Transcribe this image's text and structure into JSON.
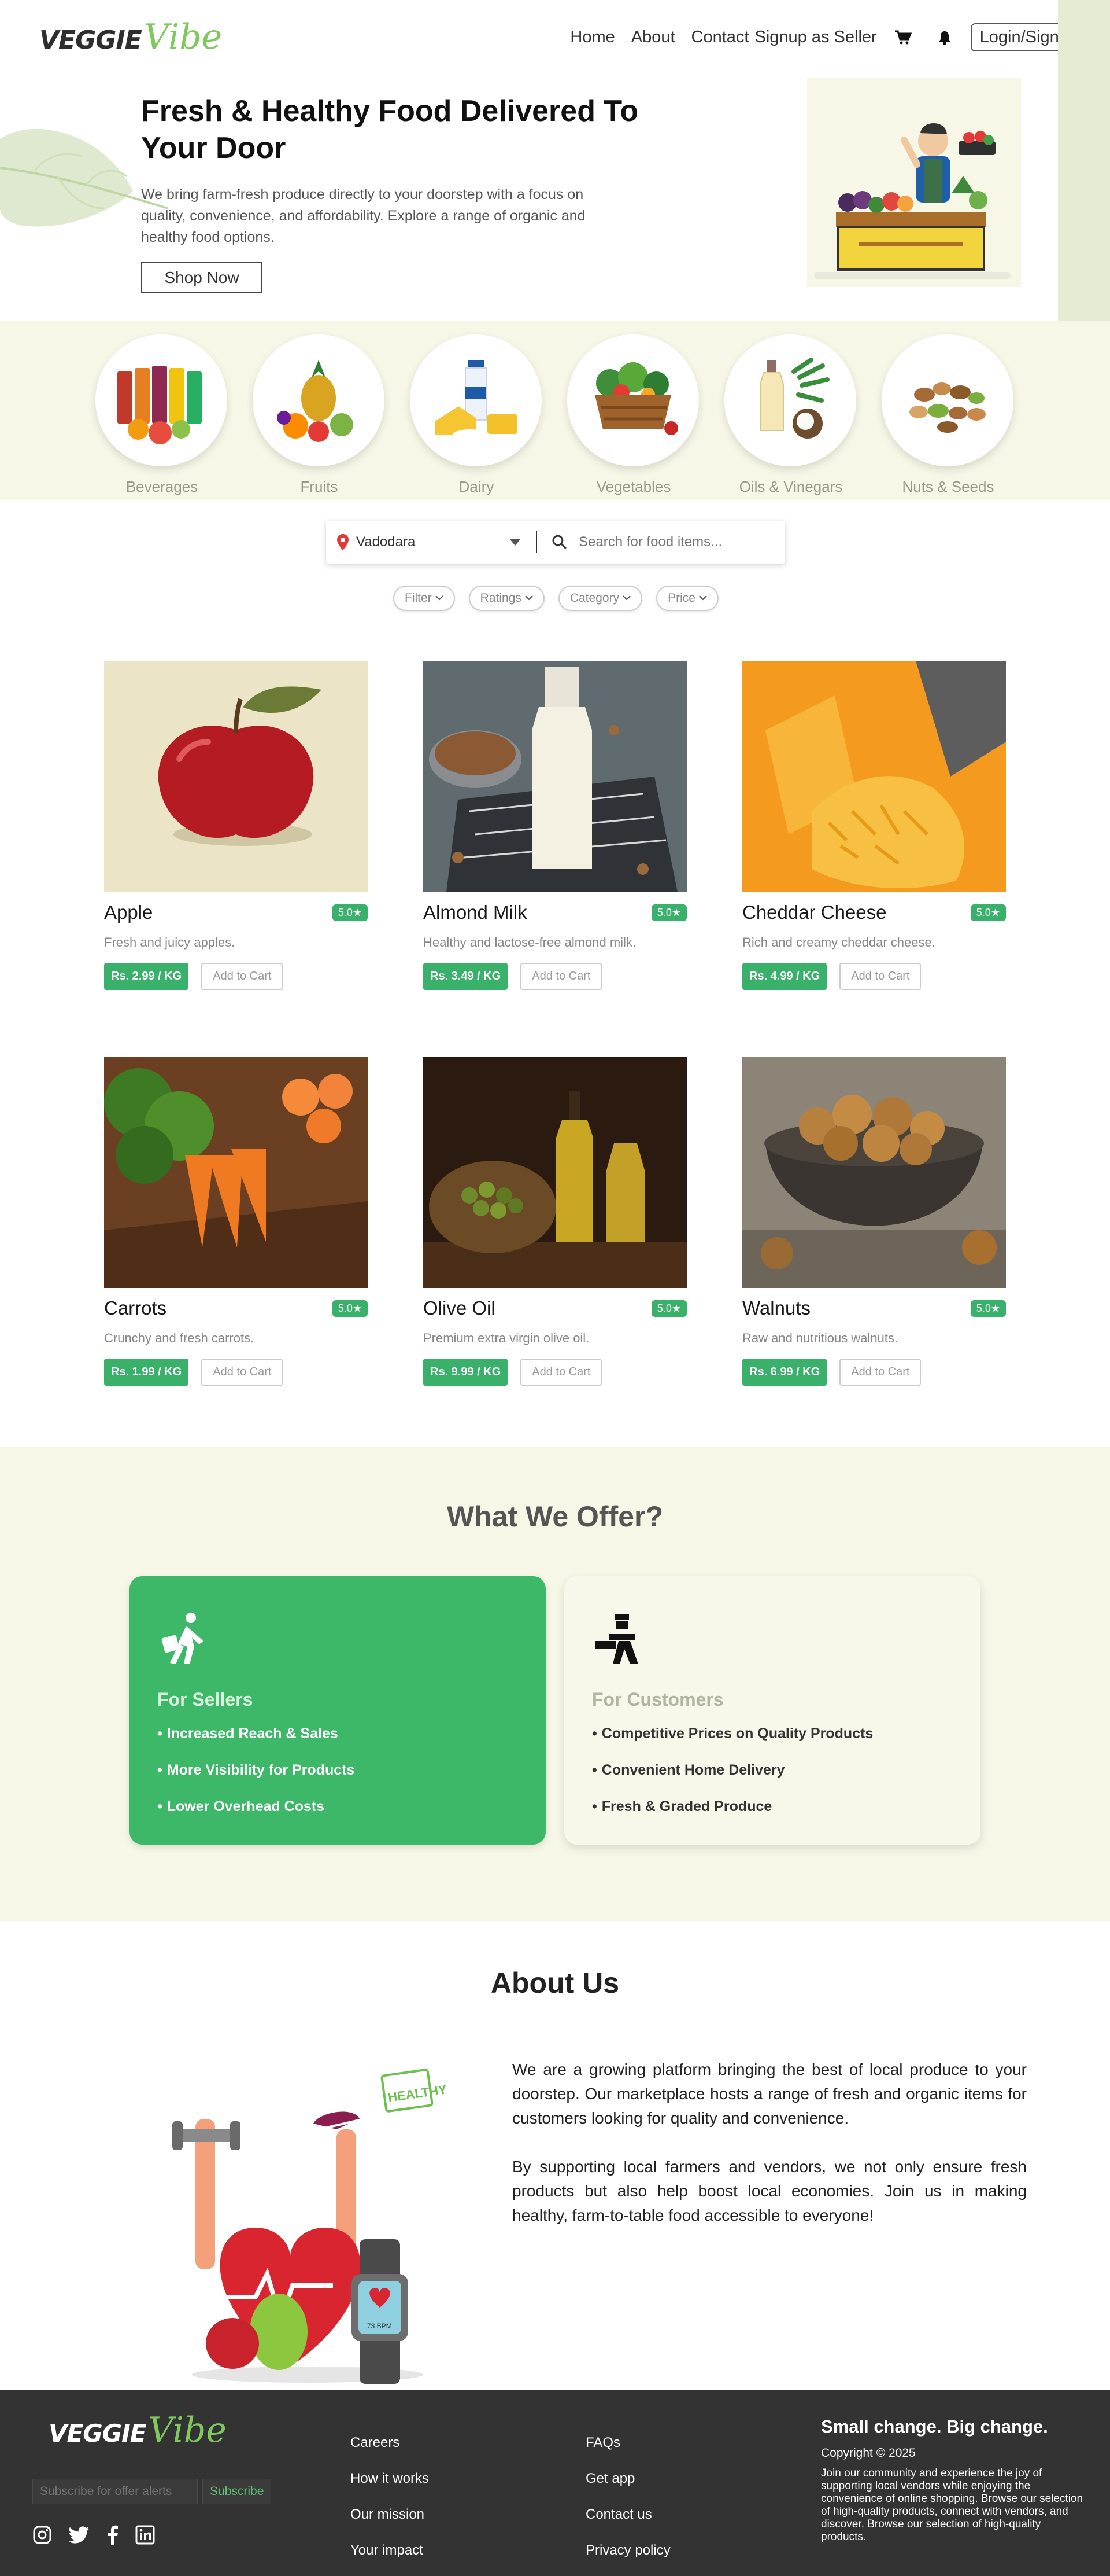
{
  "brand": {
    "logo_main": "VEGGIE",
    "logo_accent": "Vibe"
  },
  "nav": {
    "links": [
      "Home",
      "About",
      "Contact",
      "Signup as Seller"
    ],
    "login": "Login/Signup"
  },
  "hero": {
    "title": "Fresh & Healthy Food Delivered To Your Door",
    "description": "We bring farm-fresh produce directly to your doorstep with a focus on quality, convenience, and affordability. Explore a range of organic and healthy food options.",
    "cta": "Shop Now"
  },
  "categories": [
    {
      "label": "Beverages",
      "icon": "beverages-icon"
    },
    {
      "label": "Fruits",
      "icon": "fruits-icon"
    },
    {
      "label": "Dairy",
      "icon": "dairy-icon"
    },
    {
      "label": "Vegetables",
      "icon": "vegetables-icon"
    },
    {
      "label": "Oils & Vinegars",
      "icon": "oils-icon"
    },
    {
      "label": "Nuts & Seeds",
      "icon": "nuts-icon"
    }
  ],
  "search": {
    "location": "Vadodara",
    "placeholder": "Search for food items..."
  },
  "filters": [
    "Filter",
    "Ratings",
    "Category",
    "Price"
  ],
  "products": [
    {
      "name": "Apple",
      "rating": "5.0",
      "description": "Fresh and juicy apples.",
      "price": "Rs. 2.99 / KG",
      "add": "Add to Cart"
    },
    {
      "name": "Almond Milk",
      "rating": "5.0",
      "description": "Healthy and lactose-free almond milk.",
      "price": "Rs. 3.49 / KG",
      "add": "Add to Cart"
    },
    {
      "name": "Cheddar Cheese",
      "rating": "5.0",
      "description": "Rich and creamy cheddar cheese.",
      "price": "Rs. 4.99 / KG",
      "add": "Add to Cart"
    },
    {
      "name": "Carrots",
      "rating": "5.0",
      "description": "Crunchy and fresh carrots.",
      "price": "Rs. 1.99 / KG",
      "add": "Add to Cart"
    },
    {
      "name": "Olive Oil",
      "rating": "5.0",
      "description": "Premium extra virgin olive oil.",
      "price": "Rs. 9.99 / KG",
      "add": "Add to Cart"
    },
    {
      "name": "Walnuts",
      "rating": "5.0",
      "description": "Raw and nutritious walnuts.",
      "price": "Rs. 6.99 / KG",
      "add": "Add to Cart"
    }
  ],
  "offer": {
    "title": "What We Offer?",
    "sellers": {
      "heading": "For Sellers",
      "items": [
        "Increased Reach & Sales",
        "More Visibility for Products",
        "Lower Overhead Costs"
      ]
    },
    "customers": {
      "heading": "For Customers",
      "items": [
        "Competitive Prices on Quality Products",
        "Convenient Home Delivery",
        "Fresh & Graded Produce"
      ]
    }
  },
  "about": {
    "title": "About Us",
    "art_text": "HEALTHY",
    "art_watch": "73 BPM",
    "paragraphs": [
      "We are a growing platform bringing the best of local produce to your doorstep. Our marketplace hosts a range of fresh and organic items for customers looking for quality and convenience.",
      "By supporting local farmers and vendors, we not only ensure fresh products but also help boost local economies. Join us in making healthy, farm-to-table food accessible to everyone!"
    ]
  },
  "footer": {
    "subscribe_placeholder": "Subscribe for offer alerts",
    "subscribe_button": "Subscribe",
    "col1": [
      "Careers",
      "How it works",
      "Our mission",
      "Your impact"
    ],
    "col2": [
      "FAQs",
      "Get app",
      "Contact us",
      "Privacy policy"
    ],
    "tagline": "Small change. Big change.",
    "copyright": "Copyright © 2025",
    "description": "Join our community and experience the joy of supporting local vendors while enjoying the convenience of online shopping. Browse our selection of high-quality products, connect with vendors, and discover. Browse our selection of high-quality products.",
    "socials": [
      "instagram-icon",
      "twitter-icon",
      "facebook-icon",
      "linkedin-icon"
    ]
  },
  "colors": {
    "accent": "#39b16a",
    "band": "#f6f7e6",
    "footer": "#333333",
    "logo_green": "#7ec85e"
  }
}
